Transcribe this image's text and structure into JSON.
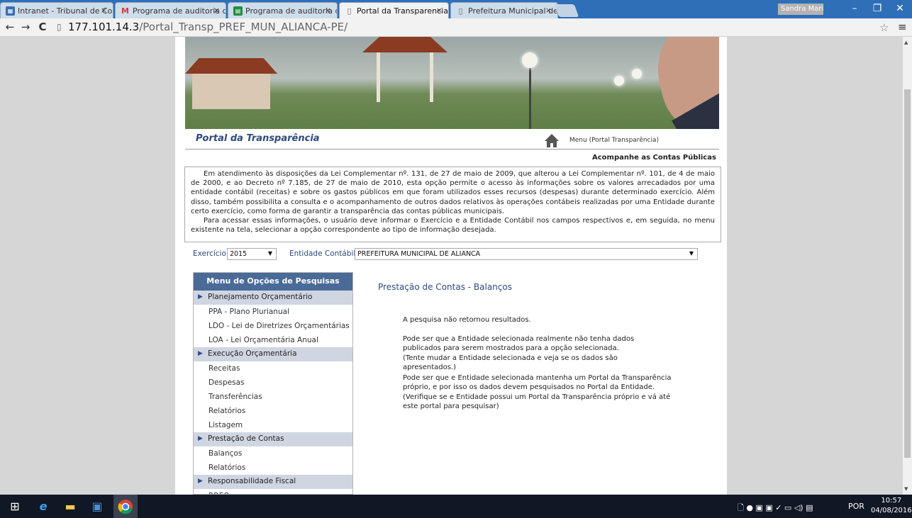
{
  "browser": {
    "tabs": [
      {
        "label": "Intranet - Tribunal de Con",
        "icon": "intranet-icon"
      },
      {
        "label": "Programa de auditoria de",
        "icon": "gmail-icon"
      },
      {
        "label": "Programa de auditoria de",
        "icon": "sheets-icon"
      },
      {
        "label": "Portal da Transparencia",
        "icon": "page-icon",
        "active": true
      },
      {
        "label": "Prefeitura Municipal de Al",
        "icon": "page-icon"
      }
    ],
    "tab_close": "×",
    "user_badge": "Sandra Maria B...",
    "controls": {
      "minimize": "–",
      "maximize": "❐",
      "close": "✕"
    },
    "nav": {
      "back": "←",
      "forward": "→",
      "reload": "C"
    },
    "url_host": "177.101.14.3",
    "url_path": "/Portal_Transp_PREF_MUN_ALIANCA-PE/",
    "star": "☆",
    "menu": "≡"
  },
  "page": {
    "portal_title": "Portal da Transparência",
    "home_link": "Menu (Portal Transparência)",
    "subtitle": "Acompanhe as Contas Públicas",
    "intro_p1": "Em atendimento às disposições da Lei Complementar nº. 131, de 27 de maio de 2009, que alterou a Lei Complementar nº. 101, de 4 de maio de 2000, e ao Decreto nº 7.185, de 27 de maio de 2010, esta opção permite o acesso às informações sobre os valores arrecadados por uma entidade contábil (receitas) e sobre os gastos públicos em que foram utilizados esses recursos (despesas) durante determinado exercício. Além disso, também possibilita a consulta e o acompanhamento de outros dados relativos às operações contábeis realizadas por uma Entidade durante certo exercício, como forma de garantir a transparência das contas públicas municipais.",
    "intro_p2": "Para acessar essas informações, o usuário deve informar o Exercício e a Entidade Contábil nos campos respectivos e, em seguida, no menu existente na tela, selecionar a opção correspondente ao tipo de informação desejada.",
    "filters": {
      "exercicio_label": "Exercício",
      "exercicio_value": "2015",
      "entidade_label": "Entidade Contábil",
      "entidade_value": "PREFEITURA MUNICIPAL DE ALIANCA"
    },
    "menu": {
      "title": "Menu de Opções de Pesquisas",
      "sections": [
        {
          "label": "Planejamento Orçamentário",
          "items": [
            "PPA - Plano Plurianual",
            "LDO - Lei de Diretrizes Orçamentárias",
            "LOA - Lei Orçamentária Anual"
          ]
        },
        {
          "label": "Execução Orçamentária",
          "items": [
            "Receitas",
            "Despesas",
            "Transferências",
            "Relatórios",
            "Listagem"
          ]
        },
        {
          "label": "Prestação de Contas",
          "items": [
            "Balanços",
            "Relatórios"
          ]
        },
        {
          "label": "Responsabilidade Fiscal",
          "items": [
            "RREO"
          ]
        }
      ]
    },
    "content": {
      "title": "Prestação de Contas - Balanços",
      "no_results": "A pesquisa não retornou resultados.",
      "para1": "Pode ser que a Entidade selecionada realmente não tenha dados publicados para serem mostrados para a opção selecionada.",
      "para1_hint": "(Tente mudar a Entidade selecionada e veja se os dados são apresentados.)",
      "para2": "Pode ser que e Entidade selecionada mantenha um Portal da Transparência próprio, e por isso os dados devem pesquisados no Portal da Entidade.",
      "para2_hint": "(Verifique se e Entidade possui um Portal da Transparência próprio e vá até este portal para pesquisar)"
    }
  },
  "taskbar": {
    "language": "POR",
    "time": "10:57",
    "date": "04/08/2016"
  }
}
